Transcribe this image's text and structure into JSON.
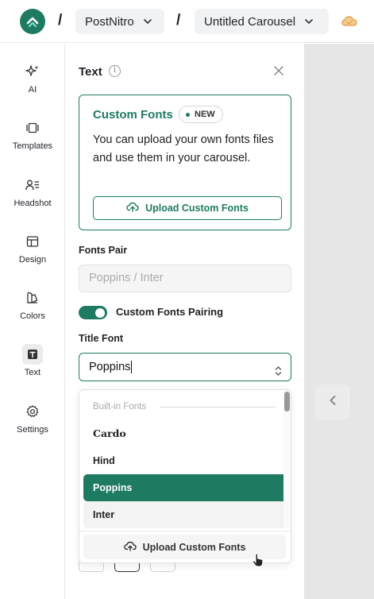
{
  "topbar": {
    "separator": "/",
    "workspace": "PostNitro",
    "document_title": "Untitled Carousel",
    "logo_icon": "postnitro-logo-icon",
    "cloud_icon": "cloud-sync-icon"
  },
  "sidebar": {
    "items": [
      {
        "label": "AI",
        "icon": "sparkles-icon"
      },
      {
        "label": "Templates",
        "icon": "templates-icon"
      },
      {
        "label": "Headshot",
        "icon": "headshot-icon"
      },
      {
        "label": "Design",
        "icon": "layout-icon"
      },
      {
        "label": "Colors",
        "icon": "palette-icon"
      },
      {
        "label": "Text",
        "icon": "text-icon",
        "active": true
      },
      {
        "label": "Settings",
        "icon": "gear-icon"
      }
    ]
  },
  "panel": {
    "title": "Text",
    "custom_fonts": {
      "title": "Custom Fonts",
      "badge": "NEW",
      "description": "You can upload your own fonts files and use them in your carousel.",
      "upload_button": "Upload Custom Fonts"
    },
    "fonts_pair": {
      "label": "Fonts Pair",
      "placeholder": "Poppins / Inter"
    },
    "pairing_toggle": {
      "label": "Custom Fonts Pairing",
      "enabled": true
    },
    "title_font": {
      "label": "Title Font",
      "value": "Poppins"
    },
    "dropdown": {
      "group_label": "Built-in Fonts",
      "options": [
        "Cardo",
        "Hind",
        "Poppins",
        "Inter"
      ],
      "selected": "Poppins",
      "footer_button": "Upload Custom Fonts"
    }
  },
  "colors": {
    "accent": "#1f7a62",
    "canvas_bg": "#e6e6e6"
  }
}
